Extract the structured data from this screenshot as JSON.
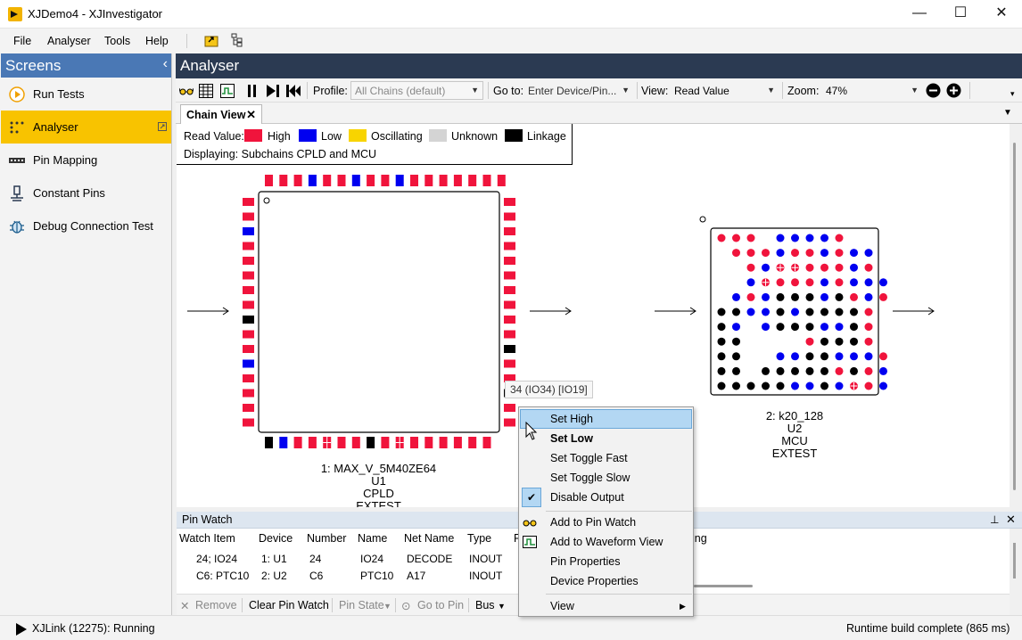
{
  "window": {
    "title": "XJDemo4 - XJInvestigator",
    "minimize_glyph": "—",
    "maximize_glyph": "☐",
    "close_glyph": "✕"
  },
  "menu": [
    "File",
    "Analyser",
    "Tools",
    "Help"
  ],
  "sidebar": {
    "header": "Screens",
    "items": [
      {
        "label": "Run Tests",
        "icon": "play-circle-icon"
      },
      {
        "label": "Analyser",
        "icon": "analyser-dots-icon",
        "active": true
      },
      {
        "label": "Pin Mapping",
        "icon": "pin-mapping-icon"
      },
      {
        "label": "Constant Pins",
        "icon": "constant-pins-icon"
      },
      {
        "label": "Debug Connection Test",
        "icon": "bug-icon"
      }
    ]
  },
  "analyser": {
    "title": "Analyser",
    "toolbar": {
      "profile_label": "Profile:",
      "profile_value": "All Chains (default)",
      "goto_label": "Go to:",
      "goto_placeholder": "Enter Device/Pin...",
      "view_label": "View:",
      "view_value": "Read Value",
      "zoom_label": "Zoom:",
      "zoom_value": "47%"
    },
    "tab": "Chain View"
  },
  "legend": {
    "title": "Read Value:",
    "entries": [
      {
        "label": "High",
        "color": "#f0143c"
      },
      {
        "label": "Low",
        "color": "#0000f0"
      },
      {
        "label": "Oscillating",
        "color": "#f8d400"
      },
      {
        "label": "Unknown",
        "color": "#d4d4d4"
      },
      {
        "label": "Linkage",
        "color": "#000000"
      }
    ],
    "displaying": "Displaying: Subchains CPLD and MCU"
  },
  "colors": {
    "high": "#f0143c",
    "low": "#0000f0",
    "linkage": "#000000"
  },
  "device1": {
    "label": [
      "1: MAX_V_5M40ZE64",
      "U1",
      "CPLD",
      "EXTEST"
    ],
    "top": "HHHLHHLHHLHHHHHHH",
    "left": "HHLHHHHHBHHLHHHHBHHHBHBB",
    "right": "HHHHHHHHHHBHHBHHHHHH",
    "bottom": "BLHHXHHBHXHHHHHH"
  },
  "tooltip": "34 (IO34) [IO19]",
  "device2": {
    "label": [
      "2: k20_128",
      "U2",
      "MCU",
      "EXTEST"
    ],
    "grid": [
      "HHH.LLLLH...",
      ".HHHLHHLHLL.",
      "..HLXXHHHLH.",
      "..LXHHHLHLLL",
      ".LHLBBBLBHLH",
      "BBLLBLBBBBH.",
      "BL.LBBBLLBH.",
      "BB....HBBBH.",
      "BB..LLBBLLLH",
      "BB.BBBBBHBHL",
      "BBBBBLLBLXHL"
    ]
  },
  "pin_watch": {
    "title": "Pin Watch",
    "columns": [
      "Watch Item",
      "Device",
      "Number",
      "Name",
      "Net Name",
      "Type",
      "R"
    ],
    "extra_column_fragment": "ing",
    "rows": [
      [
        "24; IO24",
        "1: U1",
        "24",
        "IO24",
        "DECODE",
        "INOUT"
      ],
      [
        "C6: PTC10",
        "2: U2",
        "C6",
        "PTC10",
        "A17",
        "INOUT"
      ]
    ],
    "buttons": {
      "remove": "Remove",
      "clear": "Clear Pin Watch",
      "pin_state": "Pin State",
      "goto_pin": "Go to Pin",
      "bus": "Bus"
    }
  },
  "context_menu": {
    "items": [
      "Set High",
      "Set Low",
      "Set Toggle Fast",
      "Set Toggle Slow",
      "Disable Output",
      "Add to Pin Watch",
      "Add to Waveform View",
      "Pin Properties",
      "Device Properties",
      "View"
    ]
  },
  "status": {
    "left": "XJLink (12275): Running",
    "right": "Runtime build complete (865 ms)"
  }
}
